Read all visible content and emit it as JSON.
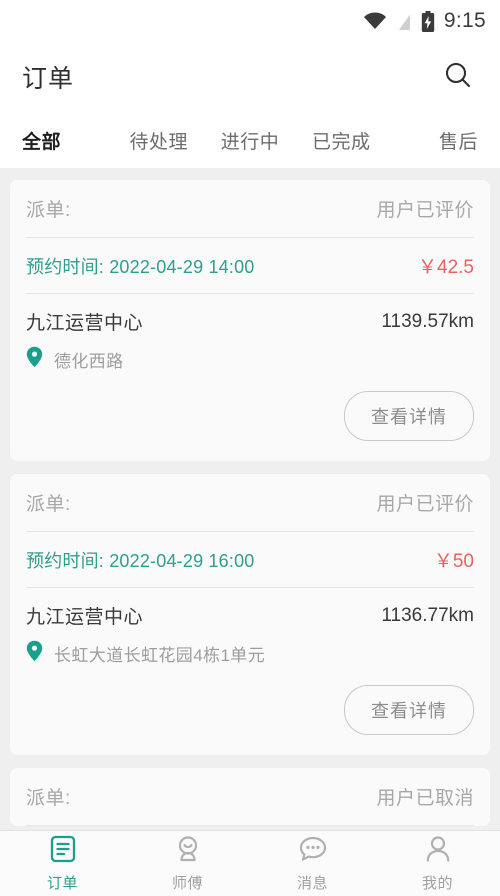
{
  "statusbar": {
    "time": "9:15",
    "icons": [
      "wifi-icon",
      "signal-off-icon",
      "battery-charging-icon"
    ]
  },
  "header": {
    "title": "订单",
    "search_icon": "search-icon"
  },
  "tabs": [
    {
      "label": "全部",
      "active": true
    },
    {
      "label": "待处理",
      "active": false
    },
    {
      "label": "进行中",
      "active": false
    },
    {
      "label": "已完成",
      "active": false
    },
    {
      "label": "售后",
      "active": false
    }
  ],
  "orders": [
    {
      "dispatch_label": "派单:",
      "status": "用户已评价",
      "appointment": "预约时间: 2022-04-29 14:00",
      "price": "￥42.5",
      "center": "九江运营中心",
      "distance": "1139.57km",
      "address": "德化西路",
      "detail_button": "查看详情"
    },
    {
      "dispatch_label": "派单:",
      "status": "用户已评价",
      "appointment": "预约时间: 2022-04-29 16:00",
      "price": "￥50",
      "center": "九江运营中心",
      "distance": "1136.77km",
      "address": "长虹大道长虹花园4栋1单元",
      "detail_button": "查看详情"
    },
    {
      "dispatch_label": "派单:",
      "status": "用户已取消"
    }
  ],
  "bottom_nav": [
    {
      "label": "订单",
      "icon": "order-document-icon",
      "active": true
    },
    {
      "label": "师傅",
      "icon": "worker-icon",
      "active": false
    },
    {
      "label": "消息",
      "icon": "chat-bubble-icon",
      "active": false
    },
    {
      "label": "我的",
      "icon": "person-icon",
      "active": false
    }
  ],
  "colors": {
    "accent_teal": "#2f9e8f",
    "price_red": "#e8635f",
    "page_bg": "#efefef",
    "card_bg": "#fafafa",
    "muted_text": "#a8a8a8"
  }
}
